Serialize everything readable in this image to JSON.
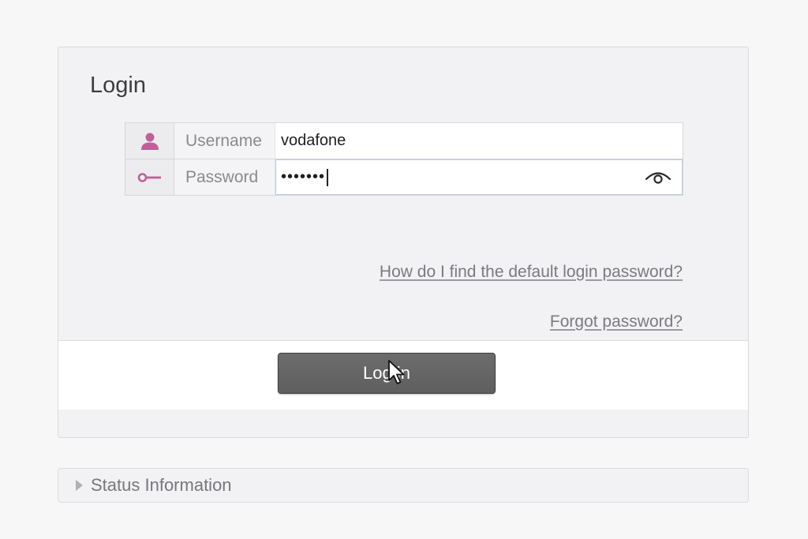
{
  "login": {
    "title": "Login",
    "username": {
      "label": "Username",
      "value": "vodafone",
      "icon": "user-icon"
    },
    "password": {
      "label": "Password",
      "masked_value": "•••••••",
      "icon": "key-icon",
      "toggle_icon": "eye-icon"
    },
    "help_default_password": "How do I find the default login password?",
    "forgot_password": "Forgot password?",
    "login_button": "Log in"
  },
  "status": {
    "label": "Status Information",
    "expanded": false
  },
  "colors": {
    "icon_accent": "#c0609a",
    "button_bg": "#636363",
    "panel_bg": "#f2f2f4"
  }
}
